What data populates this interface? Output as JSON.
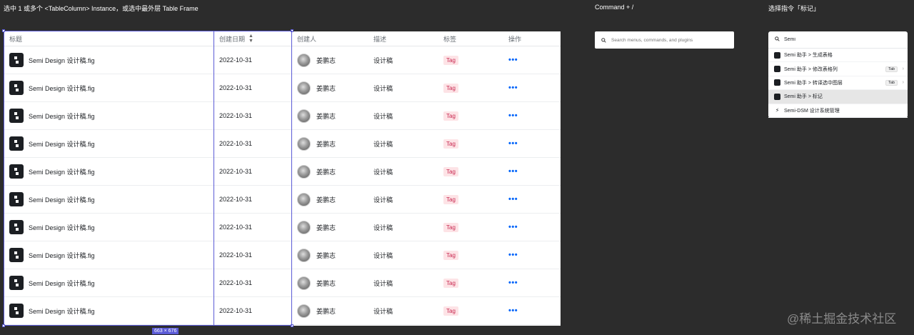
{
  "captions": {
    "step1": "选中 1 或多个 <TableColumn> Instance，或选中最外层 Table Frame",
    "step2": "Command + /",
    "step3": "选择指令「标记」"
  },
  "table": {
    "columns": [
      "标题",
      "创建日期",
      "创建人",
      "描述",
      "标签",
      "操作"
    ],
    "rows": [
      {
        "title": "Semi Design 设计稿.fig",
        "date": "2022-10-31",
        "creator": "姜鹏志",
        "desc": "设计稿",
        "tag": "Tag",
        "ops": "•••"
      },
      {
        "title": "Semi Design 设计稿.fig",
        "date": "2022-10-31",
        "creator": "姜鹏志",
        "desc": "设计稿",
        "tag": "Tag",
        "ops": "•••"
      },
      {
        "title": "Semi Design 设计稿.fig",
        "date": "2022-10-31",
        "creator": "姜鹏志",
        "desc": "设计稿",
        "tag": "Tag",
        "ops": "•••"
      },
      {
        "title": "Semi Design 设计稿.fig",
        "date": "2022-10-31",
        "creator": "姜鹏志",
        "desc": "设计稿",
        "tag": "Tag",
        "ops": "•••"
      },
      {
        "title": "Semi Design 设计稿.fig",
        "date": "2022-10-31",
        "creator": "姜鹏志",
        "desc": "设计稿",
        "tag": "Tag",
        "ops": "•••"
      },
      {
        "title": "Semi Design 设计稿.fig",
        "date": "2022-10-31",
        "creator": "姜鹏志",
        "desc": "设计稿",
        "tag": "Tag",
        "ops": "•••"
      },
      {
        "title": "Semi Design 设计稿.fig",
        "date": "2022-10-31",
        "creator": "姜鹏志",
        "desc": "设计稿",
        "tag": "Tag",
        "ops": "•••"
      },
      {
        "title": "Semi Design 设计稿.fig",
        "date": "2022-10-31",
        "creator": "姜鹏志",
        "desc": "设计稿",
        "tag": "Tag",
        "ops": "•••"
      },
      {
        "title": "Semi Design 设计稿.fig",
        "date": "2022-10-31",
        "creator": "姜鹏志",
        "desc": "设计稿",
        "tag": "Tag",
        "ops": "•••"
      },
      {
        "title": "Semi Design 设计稿.fig",
        "date": "2022-10-31",
        "creator": "姜鹏志",
        "desc": "设计稿",
        "tag": "Tag",
        "ops": "•••"
      }
    ],
    "selection_size": "663 × 676"
  },
  "command_search": {
    "placeholder": "Search menus, commands, and plugins"
  },
  "palette": {
    "query": "Semi",
    "items": [
      {
        "label": "Semi 助手 > 生成表格",
        "badge": "",
        "active": false
      },
      {
        "label": "Semi 助手 > 修改表格列",
        "badge": "Tab",
        "active": false
      },
      {
        "label": "Semi 助手 > 转译选中图层",
        "badge": "Tab",
        "active": false
      },
      {
        "label": "Semi 助手 > 标记",
        "badge": "",
        "active": true
      },
      {
        "label": "Semi-DSM 设计系统管理",
        "badge": "",
        "active": false
      }
    ]
  },
  "watermark": "@稀土掘金技术社区",
  "colors": {
    "selection": "#5b5bd6",
    "tag_bg": "#fde3e6",
    "tag_text": "#c7254e",
    "ops": "#0064fa",
    "canvas": "#2c2c2c"
  },
  "icons": [
    "search-icon",
    "semi-logo-icon",
    "sort-icon",
    "avatar",
    "more-icon",
    "chevron-right-icon"
  ]
}
